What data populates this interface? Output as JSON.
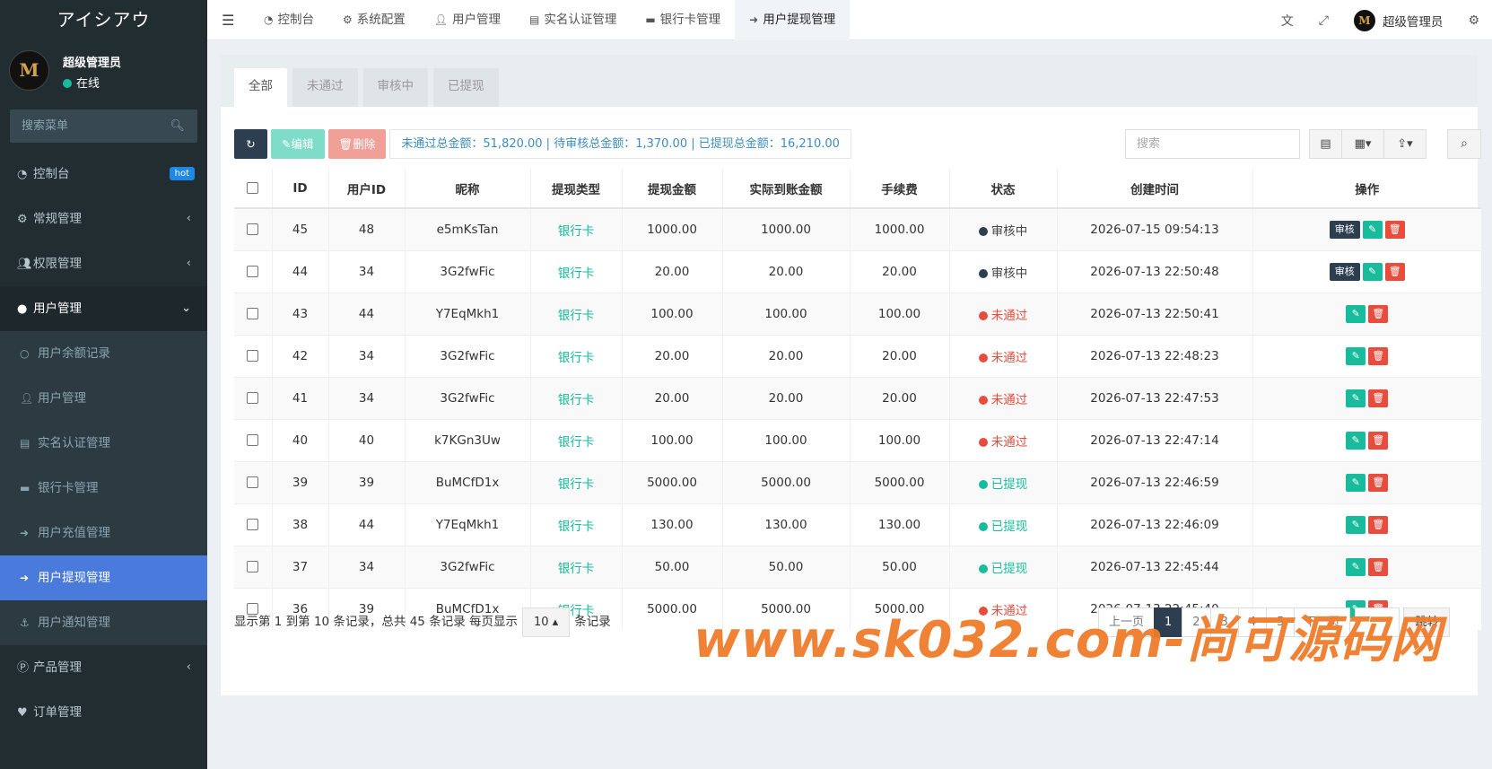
{
  "app": {
    "logo_text": "アイシアウ"
  },
  "user": {
    "avatar_letter": "M",
    "name": "超级管理员",
    "status": "在线"
  },
  "sidebar": {
    "search_placeholder": "搜索菜单",
    "items": [
      {
        "label": "控制台",
        "icon": "dashboard-icon",
        "badge": "hot"
      },
      {
        "label": "常规管理",
        "icon": "cogs-icon"
      },
      {
        "label": "权限管理",
        "icon": "users-icon"
      },
      {
        "label": "用户管理",
        "icon": "user-circle-icon"
      }
    ],
    "sub_items": [
      {
        "label": "用户余额记录",
        "icon": "circle-icon"
      },
      {
        "label": "用户管理",
        "icon": "user-icon"
      },
      {
        "label": "实名认证管理",
        "icon": "id-card-icon"
      },
      {
        "label": "银行卡管理",
        "icon": "credit-card-icon"
      },
      {
        "label": "用户充值管理",
        "icon": "sign-in-icon"
      },
      {
        "label": "用户提现管理",
        "icon": "sign-out-icon"
      },
      {
        "label": "用户通知管理",
        "icon": "anchor-icon"
      }
    ],
    "after_items": [
      {
        "label": "产品管理",
        "icon": "product-icon"
      },
      {
        "label": "订单管理",
        "icon": "heartbeat-icon"
      }
    ]
  },
  "navbar": {
    "tabs": [
      {
        "label": "控制台",
        "icon": "dashboard-icon"
      },
      {
        "label": "系统配置",
        "icon": "gear-icon"
      },
      {
        "label": "用户管理",
        "icon": "user-icon"
      },
      {
        "label": "实名认证管理",
        "icon": "id-card-icon"
      },
      {
        "label": "银行卡管理",
        "icon": "credit-card-icon"
      },
      {
        "label": "用户提现管理",
        "icon": "sign-out-icon"
      }
    ],
    "user_name": "超级管理员"
  },
  "filter_tabs": [
    "全部",
    "未通过",
    "审核中",
    "已提现"
  ],
  "toolbar": {
    "edit_label": "编辑",
    "delete_label": "删除",
    "summary": "未通过总金额：51,820.00 | 待审核总金额：1,370.00 | 已提现总金额：16,210.00",
    "search_placeholder": "搜索"
  },
  "table": {
    "columns": [
      "ID",
      "用户ID",
      "昵称",
      "提现类型",
      "提现金额",
      "实际到账金额",
      "手续费",
      "状态",
      "创建时间",
      "操作"
    ],
    "audit_label": "审核",
    "rows": [
      {
        "id": "45",
        "uid": "48",
        "nick": "e5mKsTan",
        "type": "银行卡",
        "amount": "1000.00",
        "actual": "1000.00",
        "fee": "1000.00",
        "status": "审核中",
        "status_kind": "pending",
        "time": "2026-07-15 09:54:13"
      },
      {
        "id": "44",
        "uid": "34",
        "nick": "3G2fwFic",
        "type": "银行卡",
        "amount": "20.00",
        "actual": "20.00",
        "fee": "20.00",
        "status": "审核中",
        "status_kind": "pending",
        "time": "2026-07-13 22:50:48"
      },
      {
        "id": "43",
        "uid": "44",
        "nick": "Y7EqMkh1",
        "type": "银行卡",
        "amount": "100.00",
        "actual": "100.00",
        "fee": "100.00",
        "status": "未通过",
        "status_kind": "fail",
        "time": "2026-07-13 22:50:41"
      },
      {
        "id": "42",
        "uid": "34",
        "nick": "3G2fwFic",
        "type": "银行卡",
        "amount": "20.00",
        "actual": "20.00",
        "fee": "20.00",
        "status": "未通过",
        "status_kind": "fail",
        "time": "2026-07-13 22:48:23"
      },
      {
        "id": "41",
        "uid": "34",
        "nick": "3G2fwFic",
        "type": "银行卡",
        "amount": "20.00",
        "actual": "20.00",
        "fee": "20.00",
        "status": "未通过",
        "status_kind": "fail",
        "time": "2026-07-13 22:47:53"
      },
      {
        "id": "40",
        "uid": "40",
        "nick": "k7KGn3Uw",
        "type": "银行卡",
        "amount": "100.00",
        "actual": "100.00",
        "fee": "100.00",
        "status": "未通过",
        "status_kind": "fail",
        "time": "2026-07-13 22:47:14"
      },
      {
        "id": "39",
        "uid": "39",
        "nick": "BuMCfD1x",
        "type": "银行卡",
        "amount": "5000.00",
        "actual": "5000.00",
        "fee": "5000.00",
        "status": "已提现",
        "status_kind": "done",
        "time": "2026-07-13 22:46:59"
      },
      {
        "id": "38",
        "uid": "44",
        "nick": "Y7EqMkh1",
        "type": "银行卡",
        "amount": "130.00",
        "actual": "130.00",
        "fee": "130.00",
        "status": "已提现",
        "status_kind": "done",
        "time": "2026-07-13 22:46:09"
      },
      {
        "id": "37",
        "uid": "34",
        "nick": "3G2fwFic",
        "type": "银行卡",
        "amount": "50.00",
        "actual": "50.00",
        "fee": "50.00",
        "status": "已提现",
        "status_kind": "done",
        "time": "2026-07-13 22:45:44"
      },
      {
        "id": "36",
        "uid": "39",
        "nick": "BuMCfD1x",
        "type": "银行卡",
        "amount": "5000.00",
        "actual": "5000.00",
        "fee": "5000.00",
        "status": "未通过",
        "status_kind": "fail",
        "time": "2026-07-13 22:45:40"
      }
    ]
  },
  "pagination": {
    "info_prefix": "显示第 1 到第 10 条记录，总共 45 条记录 每页显示",
    "page_size": "10",
    "info_suffix": "条记录",
    "prev": "上一页",
    "pages": [
      "1",
      "2",
      "3",
      "4",
      "5"
    ],
    "next": "下一页",
    "jump": "跳转"
  },
  "watermark": "www.sk032.com-尚可源码网",
  "colors": {
    "sidebar_bg": "#222d32",
    "accent": "#18bc9c",
    "danger": "#e74c3c",
    "primary_dark": "#2c3e50",
    "active_menu": "#4a7bdc"
  }
}
